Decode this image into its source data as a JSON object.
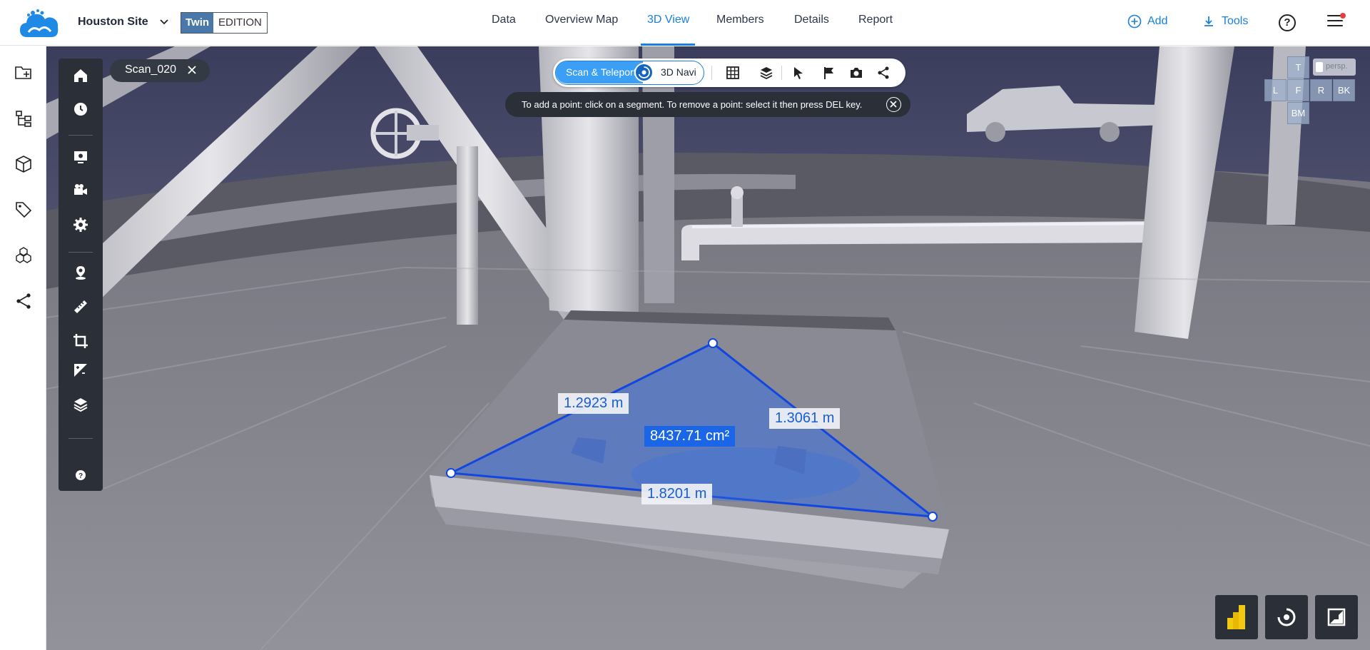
{
  "header": {
    "site_name": "Houston Site",
    "edition_twin": "Twin",
    "edition_label": "EDITION",
    "nav": [
      {
        "label": "Data",
        "active": false
      },
      {
        "label": "Overview Map",
        "active": false
      },
      {
        "label": "3D View",
        "active": true
      },
      {
        "label": "Members",
        "active": false
      },
      {
        "label": "Details",
        "active": false
      },
      {
        "label": "Report",
        "active": false
      }
    ],
    "add_label": "Add",
    "tools_label": "Tools",
    "help_glyph": "?"
  },
  "rail": {
    "icons": [
      "folder-add-icon",
      "hierarchy-icon",
      "cube-icon",
      "tag-icon",
      "cubes-icon",
      "share-icon"
    ]
  },
  "scan_chip": {
    "label": "Scan_020"
  },
  "modebar": {
    "scan_teleport": "Scan & Teleport",
    "navi": "3D Navi",
    "icons": [
      "grid-icon",
      "layers-icon",
      "cursor-icon",
      "flag-icon",
      "camera-icon",
      "share-icon"
    ]
  },
  "hint": {
    "text": "To add a point: click on a segment. To remove a point: select it then press DEL key."
  },
  "viewcube": {
    "top": "T",
    "left": "L",
    "front": "F",
    "right": "R",
    "back": "BK",
    "bottom": "BM",
    "persp": "persp."
  },
  "measurement": {
    "edge_left": "1.2923 m",
    "edge_right": "1.3061 m",
    "edge_bottom": "1.8201 m",
    "area": "8437.71 cm²"
  },
  "colors": {
    "accent": "#1a7fe0",
    "panel": "#2b3038",
    "measure_fill": "#3a6fe0"
  }
}
